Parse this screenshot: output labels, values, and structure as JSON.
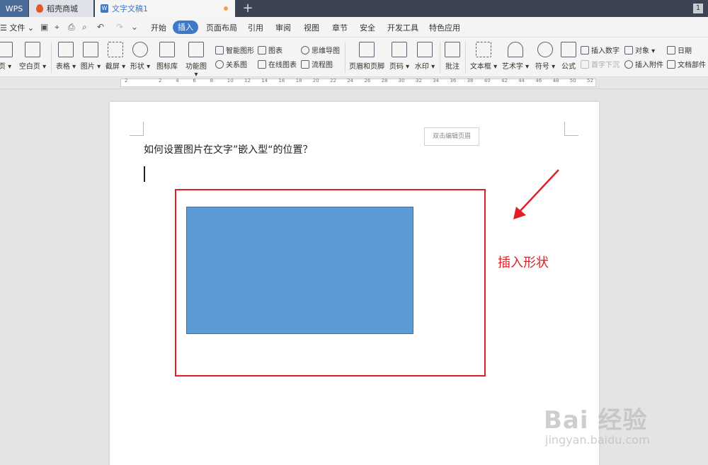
{
  "titlebar": {
    "app_tab": "WPS",
    "store_tab": "稻壳商城",
    "doc_tab": "文字文稿1",
    "doc_icon_glyph": "W",
    "window_count": "1",
    "new_tab_glyph": "+"
  },
  "menubar": {
    "file": "☰ 文件 ⌄",
    "items": [
      "开始",
      "插入",
      "页面布局",
      "引用",
      "审阅",
      "视图",
      "章节",
      "安全",
      "开发工具",
      "特色应用"
    ],
    "active_index": 1
  },
  "ribbon": {
    "page": "页 ▾",
    "blank_page": "空白页 ▾",
    "table": "表格 ▾",
    "picture": "图片 ▾",
    "screenshot": "截屏 ▾",
    "shape": "形状 ▾",
    "icon_library": "图标库",
    "function_chart": "功能图 ▾",
    "smart_art": "智能图形",
    "chart": "图表",
    "relation": "关系图",
    "online_chart": "在线图表",
    "mind_map": "思维导图",
    "flowchart": "流程图",
    "header_footer": "页眉和页脚",
    "page_number": "页码 ▾",
    "watermark": "水印 ▾",
    "comment": "批注",
    "textbox": "文本框 ▾",
    "wordart": "艺术字 ▾",
    "symbol": "符号 ▾",
    "formula": "公式",
    "insert_number": "插入数字",
    "drop_cap": "首字下沉",
    "object": "对象 ▾",
    "attachment": "插入附件",
    "date": "日期",
    "doc_parts": "文档部件"
  },
  "ruler": {
    "numbers": [
      "2",
      "2",
      "4",
      "6",
      "8",
      "10",
      "12",
      "14",
      "16",
      "18",
      "20",
      "22",
      "24",
      "26",
      "28",
      "30",
      "32",
      "34",
      "36",
      "38",
      "40",
      "42",
      "44",
      "46",
      "48",
      "50",
      "52"
    ]
  },
  "document": {
    "header_hint": "双击编辑页眉",
    "question": "如何设置图片在文字”嵌入型“的位置？",
    "annotation": "插入形状"
  },
  "watermark": {
    "brand": "Bai 经验",
    "url": "jingyan.baidu.com"
  },
  "colors": {
    "annotation_red": "#e11e26",
    "shape_blue": "#5b9bd5",
    "active_tab_blue": "#3e78c9",
    "titlebar_bg": "#3c4352"
  }
}
